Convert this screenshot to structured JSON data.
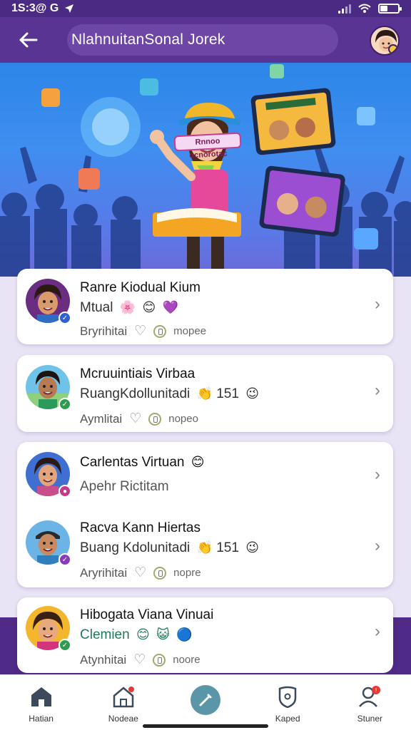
{
  "status_bar": {
    "time": "1S:3@ G"
  },
  "header": {
    "title": "NlahnuitanSonal  Jorek"
  },
  "banner": {
    "tag_text": "Rnnoo ocnorotac"
  },
  "cards": [
    {
      "items": [
        {
          "name": "Ranre Kiodual Kium",
          "subtitle": "Mtual",
          "meta": "Bryrihitai",
          "meta_sub": "mopee"
        }
      ]
    },
    {
      "items": [
        {
          "name": "Mcruuintiais Virbaa",
          "subtitle": "RuangKdollunitadi",
          "subtitle_num": "151",
          "meta": "Aymlitai",
          "meta_sub": "nopeo"
        }
      ]
    },
    {
      "items": [
        {
          "name": "Carlentas Virtuan",
          "subtitle": "Apehr Rictitam"
        },
        {
          "name": "Racva Kann Hiertas",
          "subtitle": "Buang Kdolunitadi",
          "subtitle_num": "151",
          "meta": "Aryrihitai",
          "meta_sub": "nopre"
        }
      ]
    },
    {
      "items": [
        {
          "name": "Hibogata Viana Vinuai",
          "subtitle": "Clemien",
          "meta": "Atynhitai",
          "meta_sub": "noore"
        }
      ]
    }
  ],
  "bottom_nav": [
    {
      "label": "Hatian",
      "icon": "home-filled-icon"
    },
    {
      "label": "Nodeae",
      "icon": "home-notification-icon"
    },
    {
      "label": "",
      "icon": "compose-icon"
    },
    {
      "label": "Kaped",
      "icon": "shield-icon"
    },
    {
      "label": "Stuner",
      "icon": "profile-icon"
    }
  ],
  "colors": {
    "header": "#5a3492",
    "status_bar": "#4a2a83",
    "accent": "#5b95a8",
    "notification": "#e53935"
  }
}
